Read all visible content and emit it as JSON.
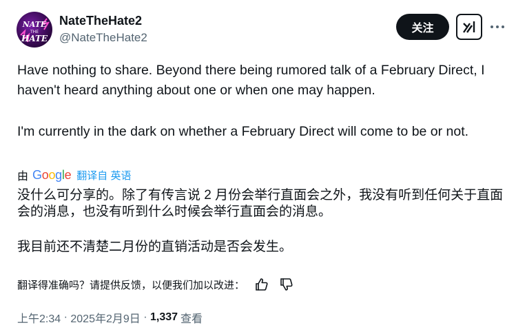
{
  "author": {
    "display_name": "NateTheHate2",
    "handle": "@NateTheHate2",
    "avatar_text": "NATE THE HATE"
  },
  "actions": {
    "follow_label": "关注",
    "grok_icon": "grok-icon",
    "more_icon": "more-icon"
  },
  "tweet": {
    "paragraph_1": "Have nothing to share. Beyond there being rumored talk of a February Direct, I haven't heard anything about one or when one may happen.",
    "paragraph_2": "I'm currently in the dark on whether a February Direct will come to be or not."
  },
  "translation": {
    "by_label": "由",
    "provider": "Google",
    "translated_from": "翻译自 英语",
    "paragraph_1": "没什么可分享的。除了有传言说 2 月份会举行直面会之外，我没有听到任何关于直面会的消息，也没有听到什么时候会举行直面会的消息。",
    "paragraph_2": "我目前还不清楚二月份的直销活动是否会发生。",
    "feedback_prompt": "翻译得准确吗？请提供反馈，以便我们加以改进："
  },
  "meta": {
    "time": "上午2:34",
    "separator_1": " · ",
    "date": "2025年2月9日",
    "separator_2": " · ",
    "views_count": "1,337",
    "views_label": "查看"
  },
  "colors": {
    "text": "#0f1419",
    "secondary": "#536471",
    "link": "#1d9bf0",
    "google_blue": "#4285F4",
    "google_red": "#EA4335",
    "google_yellow": "#FBBC05",
    "google_green": "#34A853"
  }
}
